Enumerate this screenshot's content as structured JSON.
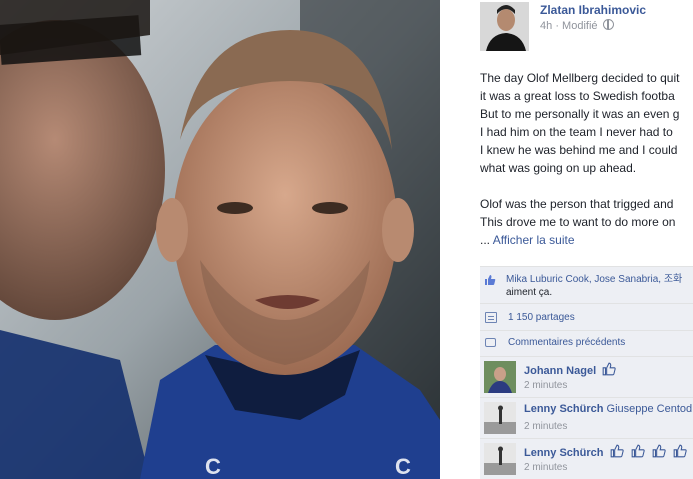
{
  "post": {
    "author": "Zlatan Ibrahimovic",
    "time": "4h",
    "separator": "·",
    "edited": "Modifié",
    "paragraph1": [
      "The day Olof Mellberg decided to quit",
      "it was a great loss to Swedish footba",
      "But to me personally it was an even g",
      "I had him on the team I never had to",
      "I knew he was behind me and I could",
      "what was going on up ahead."
    ],
    "paragraph2": [
      "Olof was the person that trigged and",
      "This drove me to want to do more on"
    ],
    "see_more_prefix": "...",
    "see_more": "Afficher la suite"
  },
  "ufi": {
    "likes_line1": "Mika Luburic Cook, Jose Sanabria, 조화",
    "likes_line2": "aiment ça.",
    "shares": "1 150 partages",
    "previous_comments": "Commentaires précédents",
    "comments": [
      {
        "author": "Johann Nagel",
        "tagged": "",
        "time": "2 minutes"
      },
      {
        "author": "Lenny Schürch",
        "tagged": "Giuseppe Centod",
        "time": "2 minutes"
      },
      {
        "author": "Lenny Schürch",
        "tagged": "",
        "time": "2 minutes"
      }
    ]
  },
  "colors": {
    "link": "#3b5998",
    "ufi_bg": "#edeff4",
    "jersey": "#1f3f8f"
  },
  "icons": [
    "globe-icon",
    "like-icon",
    "share-icon",
    "comment-icon",
    "thumbs-up-icon"
  ]
}
